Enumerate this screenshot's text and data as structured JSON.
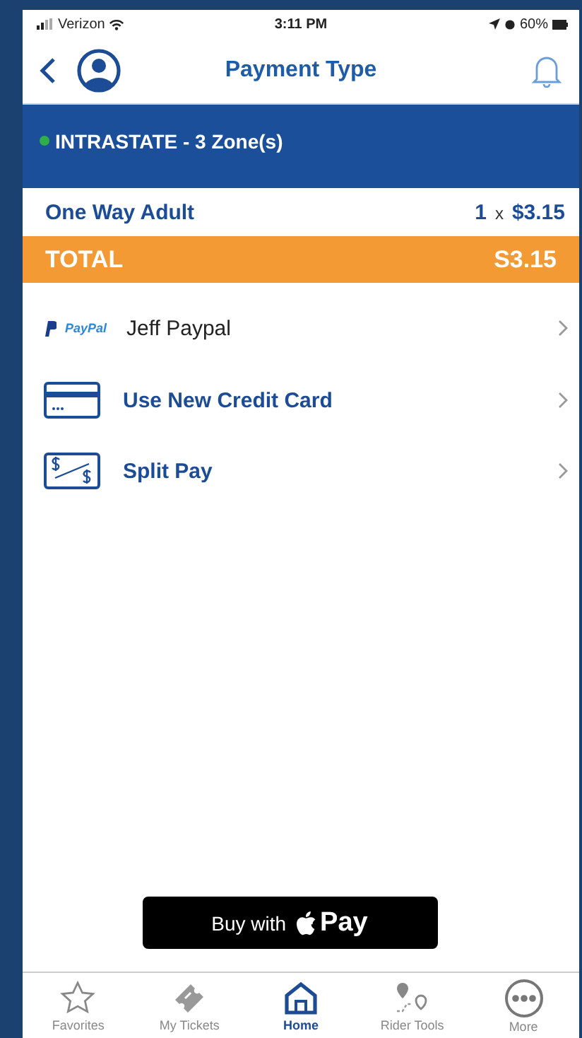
{
  "status_bar": {
    "carrier": "Verizon",
    "time": "3:11 PM",
    "battery": "60%"
  },
  "header": {
    "title": "Payment Type"
  },
  "zone": {
    "label": "INTRASTATE - 3 Zone(s)",
    "color": "#2fae4a"
  },
  "ticket": {
    "name": "One Way Adult",
    "quantity": "1",
    "times": "x",
    "price": "$3.15"
  },
  "total": {
    "label": "TOTAL",
    "amount": "S3.15"
  },
  "payment_options": [
    {
      "kind": "paypal",
      "brand": "PayPal",
      "label": "Jeff Paypal"
    },
    {
      "kind": "card",
      "label": "Use New Credit Card"
    },
    {
      "kind": "split",
      "label": "Split Pay"
    }
  ],
  "apple_pay_button": {
    "prefix": "Buy with",
    "suffix": "Pay"
  },
  "tab_bar": [
    {
      "kind": "star",
      "label": "Favorites",
      "selected": false
    },
    {
      "kind": "ticket",
      "label": "My Tickets",
      "selected": false
    },
    {
      "kind": "home",
      "label": "Home",
      "selected": true
    },
    {
      "kind": "pins",
      "label": "Rider Tools",
      "selected": false
    },
    {
      "kind": "more",
      "label": "More",
      "selected": false
    }
  ]
}
